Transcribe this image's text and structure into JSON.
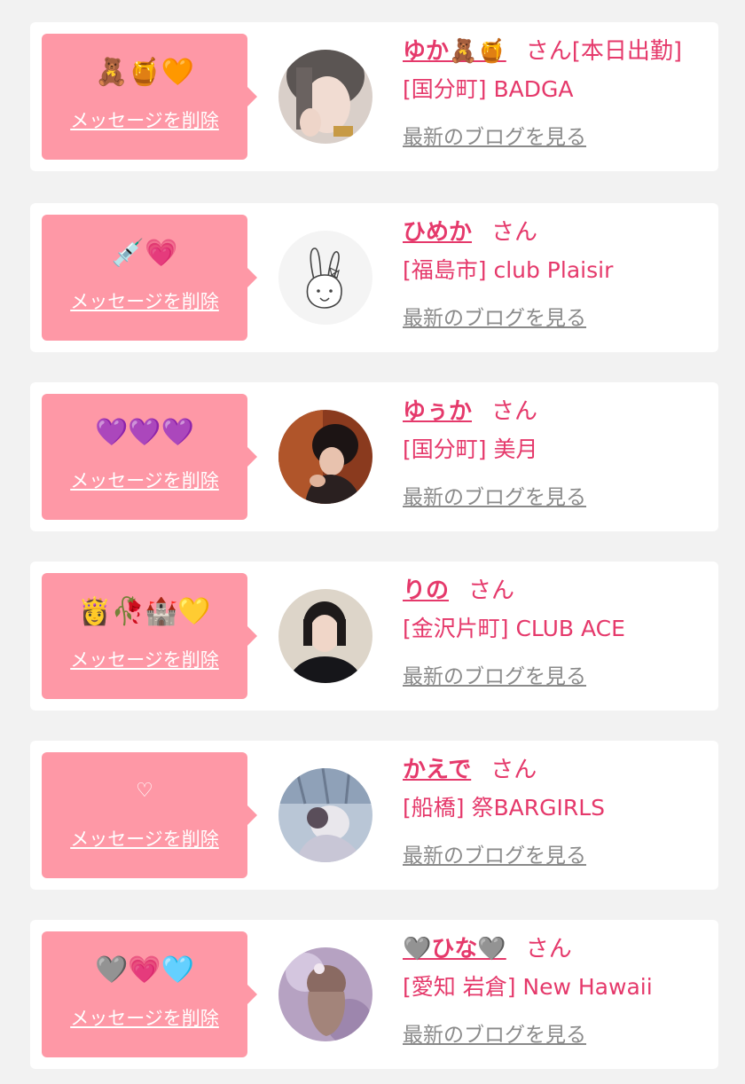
{
  "messages": [
    {
      "emoji": "🧸🍯🧡",
      "delete_label": "メッセージを削除",
      "name": "ゆか🧸🍯",
      "honorific": "さん",
      "status": "[本日出勤]",
      "location": "[国分町] BADGA",
      "blog_label": "最新のブログを見る",
      "avatar_icon": "profile-photo-short-grey-hair"
    },
    {
      "emoji": "💉💗",
      "delete_label": "メッセージを削除",
      "name": "ひめか",
      "honorific": "さん",
      "status": "",
      "location": "[福島市] club Plaisir",
      "blog_label": "最新のブログを見る",
      "avatar_icon": "bunny-drawing"
    },
    {
      "emoji": "💜💜💜",
      "delete_label": "メッセージを削除",
      "name": "ゆぅか",
      "honorific": "さん",
      "status": "",
      "location": "[国分町] 美月",
      "blog_label": "最新のブログを見る",
      "avatar_icon": "profile-photo-dark-hair"
    },
    {
      "emoji": "👸🥀🏰💛",
      "delete_label": "メッセージを削除",
      "name": "りの",
      "honorific": "さん",
      "status": "",
      "location": "[金沢片町] CLUB ACE",
      "blog_label": "最新のブログを見る",
      "avatar_icon": "profile-photo-bob-hair"
    },
    {
      "emoji": "♡",
      "delete_label": "メッセージを削除",
      "name": "かえで",
      "honorific": "さん",
      "status": "",
      "location": "[船橋] 祭BARGIRLS",
      "blog_label": "最新のブログを見る",
      "avatar_icon": "profile-photo-outdoor"
    },
    {
      "emoji": "🩶💗🩵",
      "delete_label": "メッセージを削除",
      "name": "🩶ひな🩶",
      "honorific": "さん",
      "status": "",
      "location": "[愛知 岩倉] New Hawaii",
      "blog_label": "最新のブログを見る",
      "avatar_icon": "profile-photo-purple-back"
    }
  ],
  "colors": {
    "background": "#f2f2f2",
    "card": "#ffffff",
    "bubble": "#fe98a6",
    "accent": "#e5396b",
    "link_grey": "#8a8a8a"
  }
}
